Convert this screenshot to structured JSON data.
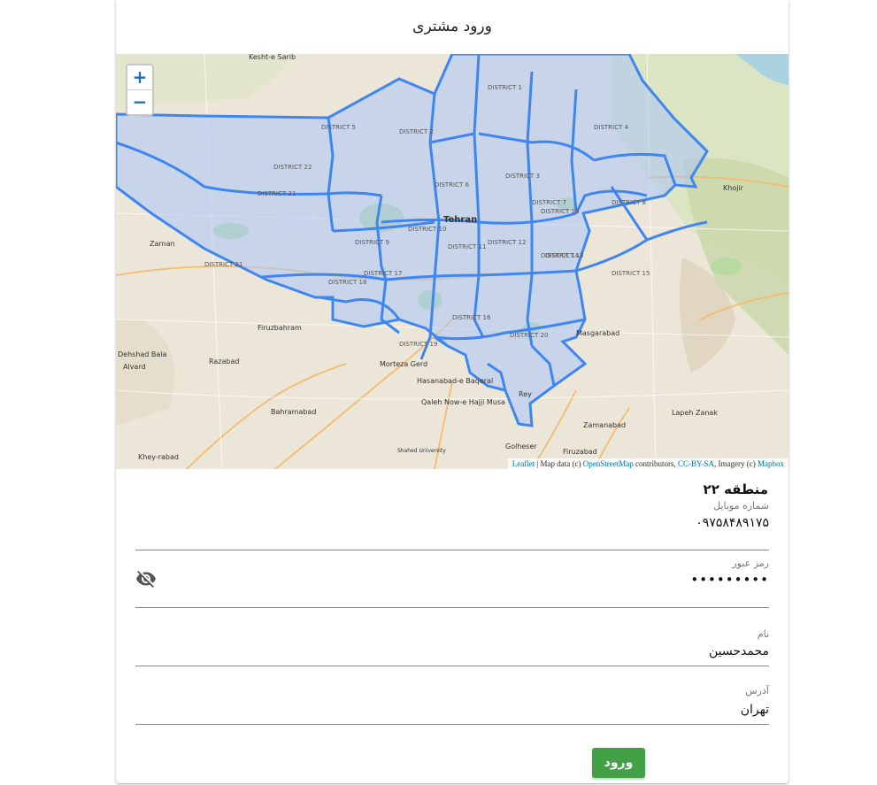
{
  "page": {
    "title": "ورود مشتری"
  },
  "map": {
    "zoom_in": "+",
    "zoom_out": "−",
    "attribution": {
      "leaflet": "Leaflet",
      "sep1": " | Map data (c) ",
      "osm": "OpenStreetMap",
      "sep2": " contributors, ",
      "license": "CC-BY-SA",
      "sep3": ", Imagery (c) ",
      "mapbox": "Mapbox"
    },
    "places": {
      "tehran": "Tehran",
      "zarnan": "Zarnan",
      "firuzbahram": "Firuzbahram",
      "razabad": "Razabad",
      "dehshad": "Dehshad Bala",
      "alvard": "Alvard",
      "bahramabad": "Bahramabad",
      "khey": "Khey-rabad",
      "morteza": "Morteza Gerd",
      "hasanabad": "Hasanabad-e Baqeral",
      "qaleh": "Qaleh Now-e Hajji Musa",
      "shahed": "Shahed University",
      "golheser": "Golheser",
      "firuzabad": "Firuzabad",
      "zamanabad": "Zamanabad",
      "lapeh": "Lapeh Zanak",
      "masgarabad": "Masgarabad",
      "khojir": "Khojir",
      "kesht": "Kesht-e Sarib",
      "nasrabad": "Nasrabad",
      "rey": "Rey",
      "d1": "DISTRICT 1",
      "d2": "DISTRICT 2",
      "d3": "DISTRICT 3",
      "d4": "DISTRICT 4",
      "d5": "DISTRICT 5",
      "d6": "DISTRICT 6",
      "d7": "DISTRICT 7",
      "d8": "DISTRICT 8",
      "d9": "DISTRICT 9",
      "d10": "DISTRICT 10",
      "d11": "DISTRICT 11",
      "d12": "DISTRICT 12",
      "d13": "DISTRICT 13",
      "d14": "DISTRICT 14",
      "d15": "DISTRICT 15",
      "d16": "DISTRICT 16",
      "d17": "DISTRICT 17",
      "d18": "DISTRICT 18",
      "d19": "DISTRICT 19",
      "d20": "DISTRICT 20",
      "d21": "DISTRICT 21",
      "d22": "DISTRICT 22"
    }
  },
  "region": {
    "label": "منطقه ۲۲"
  },
  "form": {
    "mobile": {
      "label": "شماره موبایل",
      "value": "۰۹۷۵۸۴۸۹۱۷۵"
    },
    "password": {
      "label": "رمز عبور",
      "value": "•••••••••"
    },
    "name": {
      "label": "نام",
      "value": "محمدحسین"
    },
    "address": {
      "label": "آدرس",
      "value": "تهران"
    },
    "submit": "ورود"
  },
  "colors": {
    "accent": "#43a047",
    "district_fill": "#a9c4f5",
    "district_stroke": "#3f86f0"
  }
}
